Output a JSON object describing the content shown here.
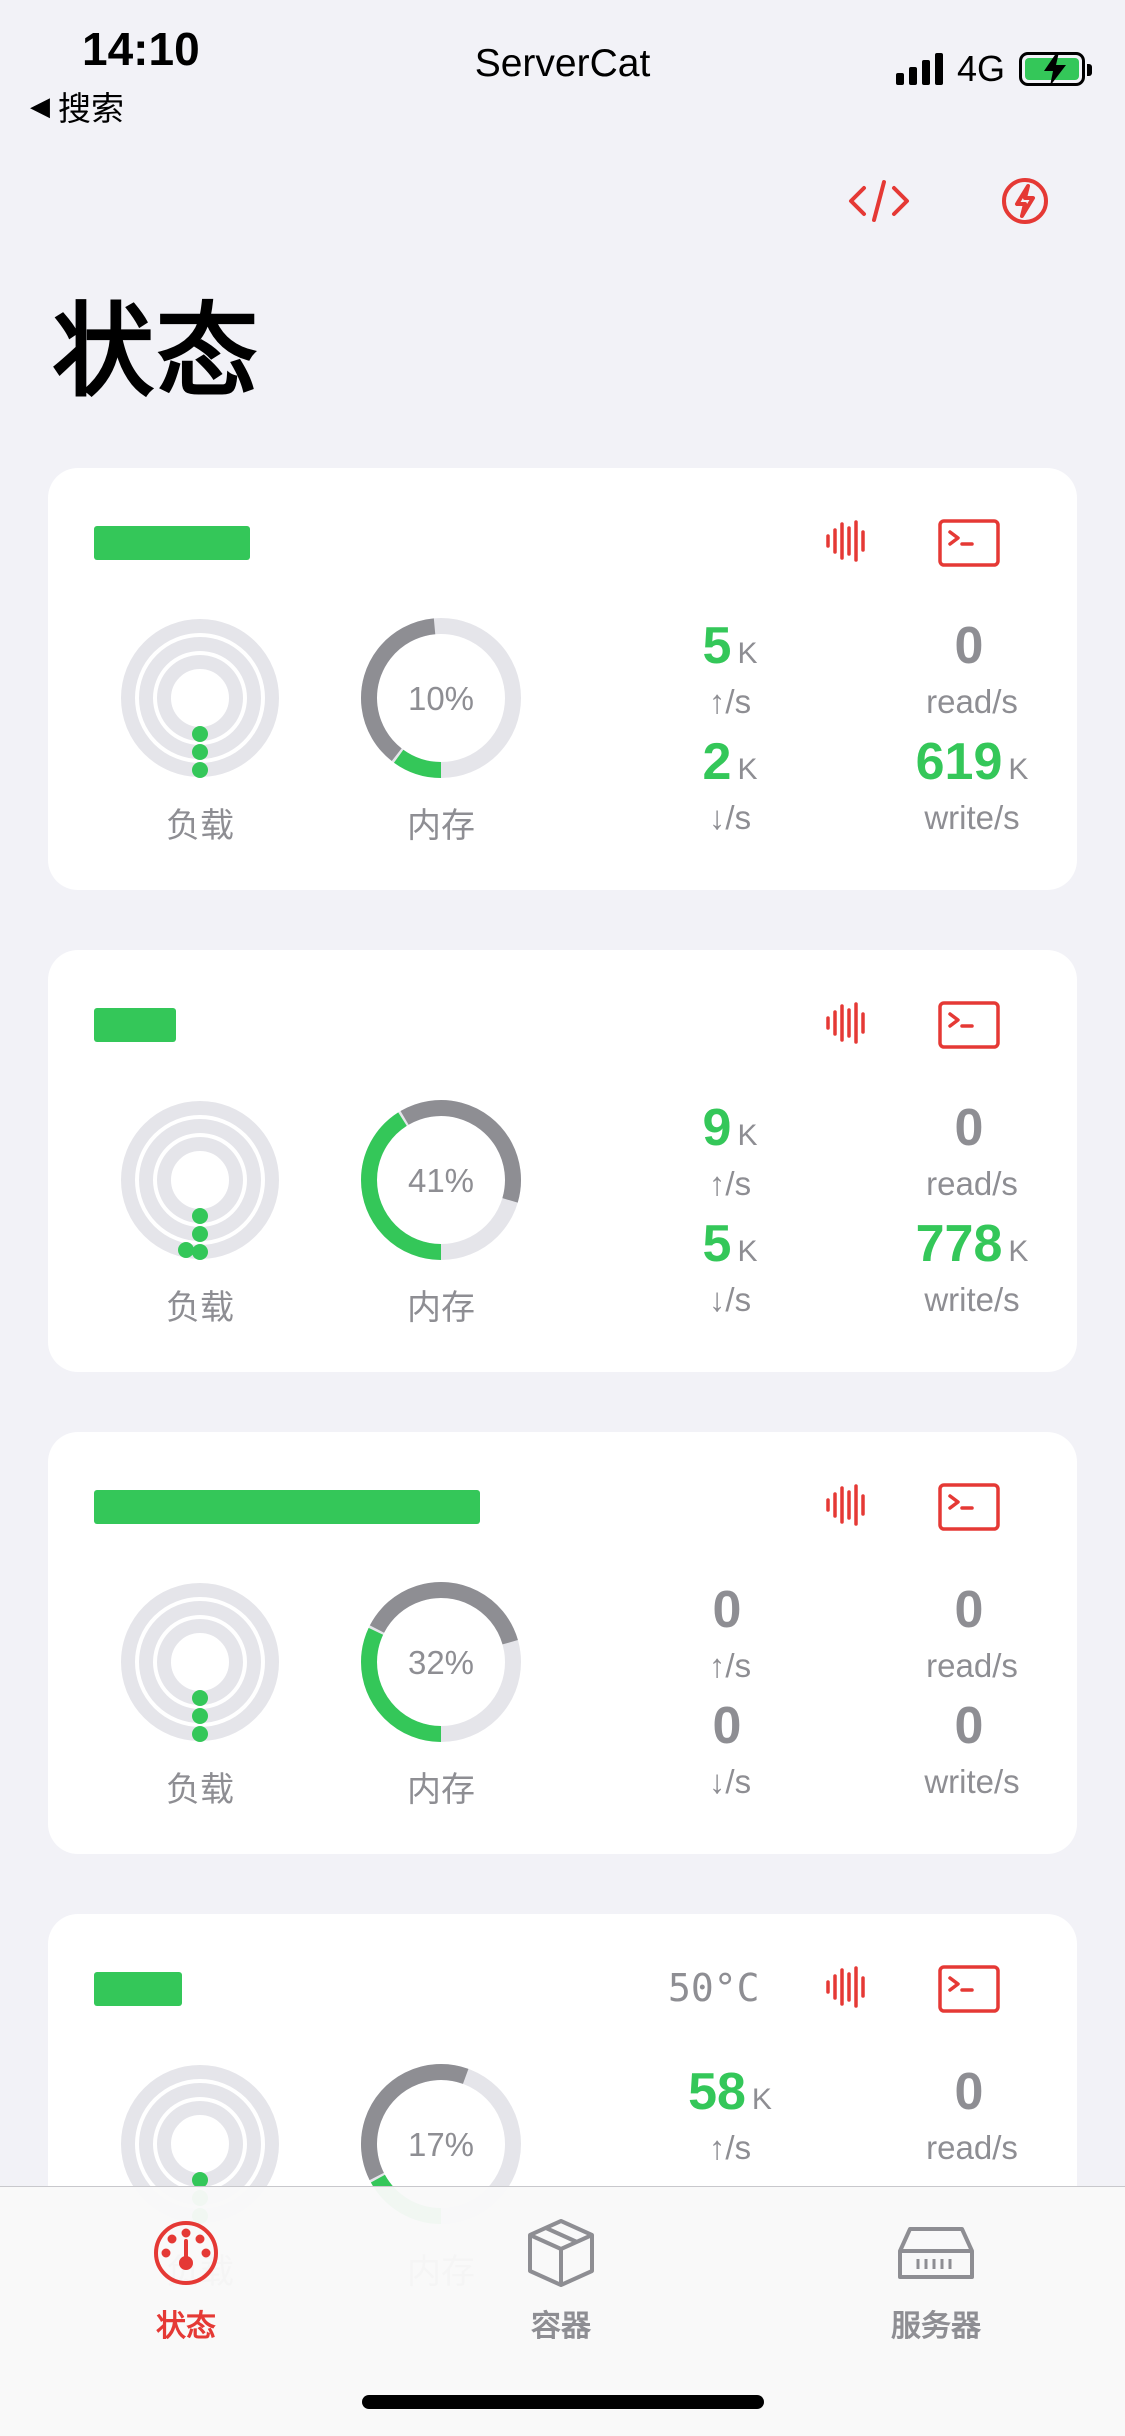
{
  "status_bar": {
    "time": "14:10",
    "back_label": "搜索",
    "app_name": "ServerCat",
    "network": "4G"
  },
  "page": {
    "title": "状态"
  },
  "nav": {
    "code_icon": "code-icon",
    "bolt_icon": "bolt-icon"
  },
  "colors": {
    "accent_red": "#e53935",
    "green": "#34c759",
    "gray": "#8e8e93",
    "ring_gray": "#e5e5ea"
  },
  "labels": {
    "load": "负载",
    "memory": "内存"
  },
  "servers": [
    {
      "name_redacted": true,
      "temperature": "",
      "load_fraction": 0.12,
      "memory_percent": 10,
      "memory_label": "10%",
      "up": {
        "value": "5",
        "unit": "K",
        "label": "↑/s"
      },
      "down": {
        "value": "2",
        "unit": "K",
        "label": "↓/s"
      },
      "read": {
        "value": "0",
        "unit": "",
        "label": "read/s"
      },
      "write": {
        "value": "619",
        "unit": "K",
        "label": "write/s"
      }
    },
    {
      "name_redacted": true,
      "temperature": "",
      "load_fraction": 0.2,
      "memory_percent": 41,
      "memory_label": "41%",
      "up": {
        "value": "9",
        "unit": "K",
        "label": "↑/s"
      },
      "down": {
        "value": "5",
        "unit": "K",
        "label": "↓/s"
      },
      "read": {
        "value": "0",
        "unit": "",
        "label": "read/s"
      },
      "write": {
        "value": "778",
        "unit": "K",
        "label": "write/s"
      }
    },
    {
      "name_redacted": true,
      "temperature": "",
      "load_fraction": 0.12,
      "memory_percent": 32,
      "memory_label": "32%",
      "up": {
        "value": "0",
        "unit": "",
        "label": "↑/s"
      },
      "down": {
        "value": "0",
        "unit": "",
        "label": "↓/s"
      },
      "read": {
        "value": "0",
        "unit": "",
        "label": "read/s"
      },
      "write": {
        "value": "0",
        "unit": "",
        "label": "write/s"
      }
    },
    {
      "name_redacted": true,
      "temperature": "50°C",
      "load_fraction": 0.1,
      "memory_percent": 17,
      "memory_label": "17%",
      "up": {
        "value": "58",
        "unit": "K",
        "label": "↑/s"
      },
      "down": {
        "value": "",
        "unit": "",
        "label": ""
      },
      "read": {
        "value": "0",
        "unit": "",
        "label": "read/s"
      },
      "write": {
        "value": "",
        "unit": "",
        "label": ""
      }
    }
  ],
  "tabbar": [
    {
      "label": "状态",
      "icon": "gauge-icon",
      "active": true
    },
    {
      "label": "容器",
      "icon": "box-icon",
      "active": false
    },
    {
      "label": "服务器",
      "icon": "server-icon",
      "active": false
    }
  ]
}
